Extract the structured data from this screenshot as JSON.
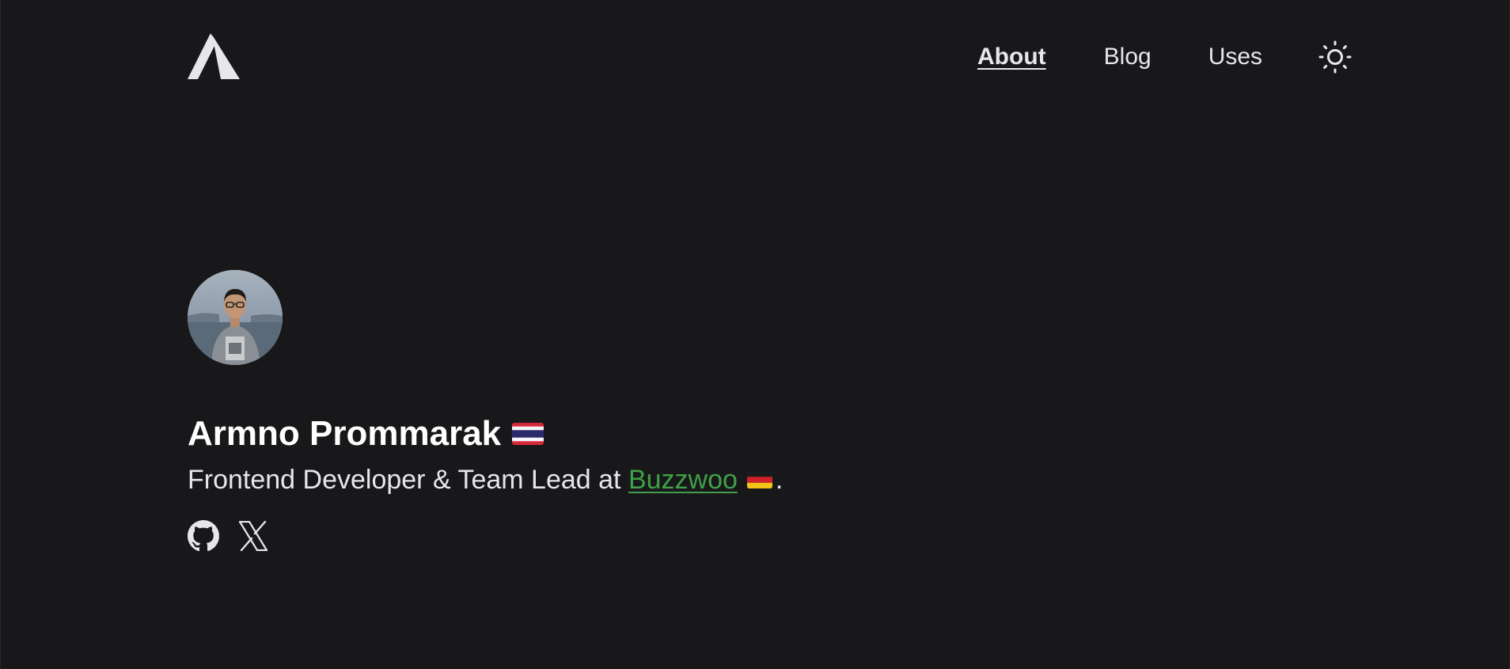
{
  "header": {
    "logo": {
      "icon": "triangle-a-logo"
    },
    "nav": {
      "items": [
        {
          "label": "About",
          "active": true
        },
        {
          "label": "Blog",
          "active": false
        },
        {
          "label": "Uses",
          "active": false
        }
      ]
    },
    "theme_toggle": {
      "icon": "sun-icon"
    }
  },
  "profile": {
    "avatar": {
      "icon": "profile-photo"
    },
    "name": "Armno Prommarak",
    "name_flag": "thailand-flag",
    "tagline_prefix": "Frontend Developer & Team Lead at ",
    "company": "Buzzwoo",
    "company_flag": "germany-flag",
    "tagline_suffix": ".",
    "socials": [
      {
        "icon": "github-icon"
      },
      {
        "icon": "x-icon"
      }
    ]
  },
  "colors": {
    "background": "#18181b",
    "text": "#e7e7ea",
    "heading": "#ffffff",
    "accent_link": "#3fa047"
  }
}
